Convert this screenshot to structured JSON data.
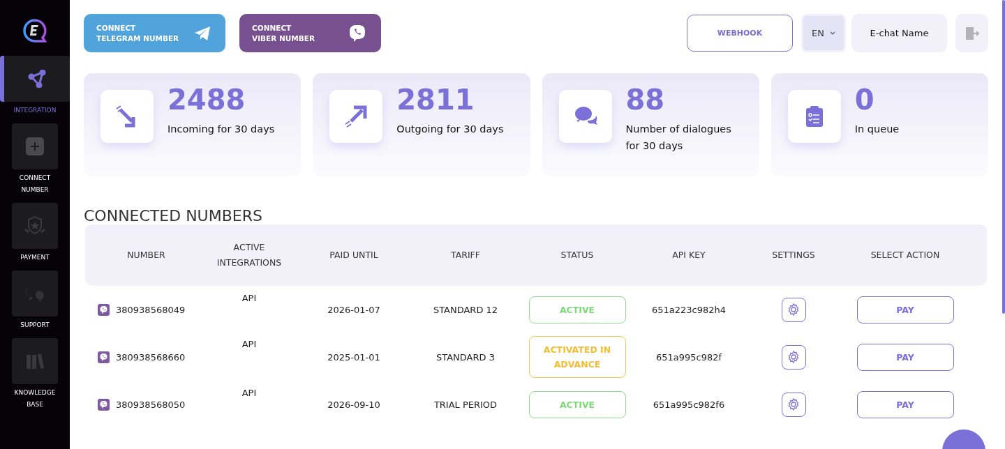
{
  "sidebar": {
    "items": [
      {
        "label": "INTEGRATION",
        "kind": "integration",
        "selected": true
      },
      {
        "label": "CONNECT NUMBER",
        "kind": "plus",
        "selected": false
      },
      {
        "label": "PAYMENT",
        "kind": "shield",
        "selected": false
      },
      {
        "label": "SUPPORT",
        "kind": "support",
        "selected": false
      },
      {
        "label": "KNOWLEDGE BASE",
        "kind": "books",
        "selected": false
      }
    ]
  },
  "header": {
    "connect_buttons": [
      {
        "label": "CONNECT\nTELEGRAM NUMBER",
        "kind": "telegram"
      },
      {
        "label": "CONNECT\nVIBER NUMBER",
        "kind": "viber"
      }
    ],
    "webhook": "WEBHOOK",
    "language": "EN",
    "account_name": "E-chat Name"
  },
  "stats": [
    {
      "value": "2488",
      "label": "Incoming for 30 days",
      "kind": "incoming"
    },
    {
      "value": "2811",
      "label": "Outgoing for 30 days",
      "kind": "outgoing"
    },
    {
      "value": "88",
      "label": "Number of dialogues for 30 days",
      "kind": "dialogues"
    },
    {
      "value": "0",
      "label": "In queue",
      "kind": "queue"
    }
  ],
  "section_title": "CONNECTED NUMBERS",
  "table": {
    "columns": [
      "NUMBER",
      "ACTIVE INTEGRATIONS",
      "PAID UNTIL",
      "TARIFF",
      "STATUS",
      "API KEY",
      "SETTINGS",
      "SELECT ACTION"
    ],
    "rows": [
      {
        "number": "380938568049",
        "integrations": "API",
        "paid_until": "2026-01-07",
        "tariff": "STANDARD 12",
        "status": {
          "label": "ACTIVE",
          "kind": "active"
        },
        "api_key": "651a223c982h4",
        "action": "PAY"
      },
      {
        "number": "380938568660",
        "integrations": "API",
        "paid_until": "2025-01-01",
        "tariff": "STANDARD 3",
        "status": {
          "label": "ACTIVATED IN ADVANCE",
          "kind": "advance"
        },
        "api_key": "651a995c982f",
        "action": "PAY"
      },
      {
        "number": "380938568050",
        "integrations": "API",
        "paid_until": "2026-09-10",
        "tariff": "TRIAL PERIOD",
        "status": {
          "label": "ACTIVE",
          "kind": "active"
        },
        "api_key": "651a995c982f6",
        "action": "PAY"
      }
    ]
  }
}
